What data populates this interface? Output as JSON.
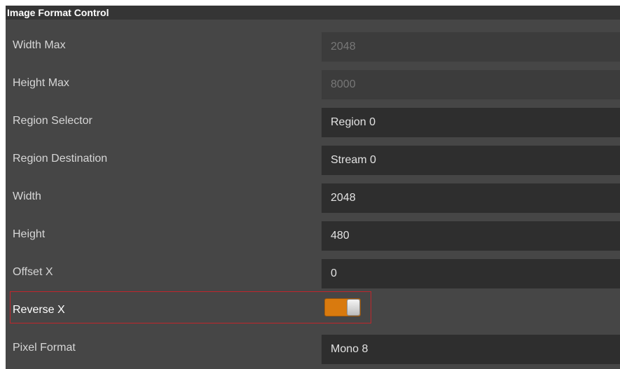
{
  "section": {
    "title": "Image Format Control"
  },
  "rows": [
    {
      "label": "Width Max",
      "value": "2048"
    },
    {
      "label": "Height Max",
      "value": "8000"
    },
    {
      "label": "Region Selector",
      "value": "Region 0"
    },
    {
      "label": "Region Destination",
      "value": "Stream 0"
    },
    {
      "label": "Width",
      "value": "2048"
    },
    {
      "label": "Height",
      "value": "480"
    },
    {
      "label": "Offset X",
      "value": "0"
    },
    {
      "label": "Reverse X",
      "toggle_state": "on"
    },
    {
      "label": "Pixel Format",
      "value": "Mono 8"
    }
  ],
  "colors": {
    "toggle_on": "#d97a0e",
    "highlight_border": "#c0262c"
  }
}
